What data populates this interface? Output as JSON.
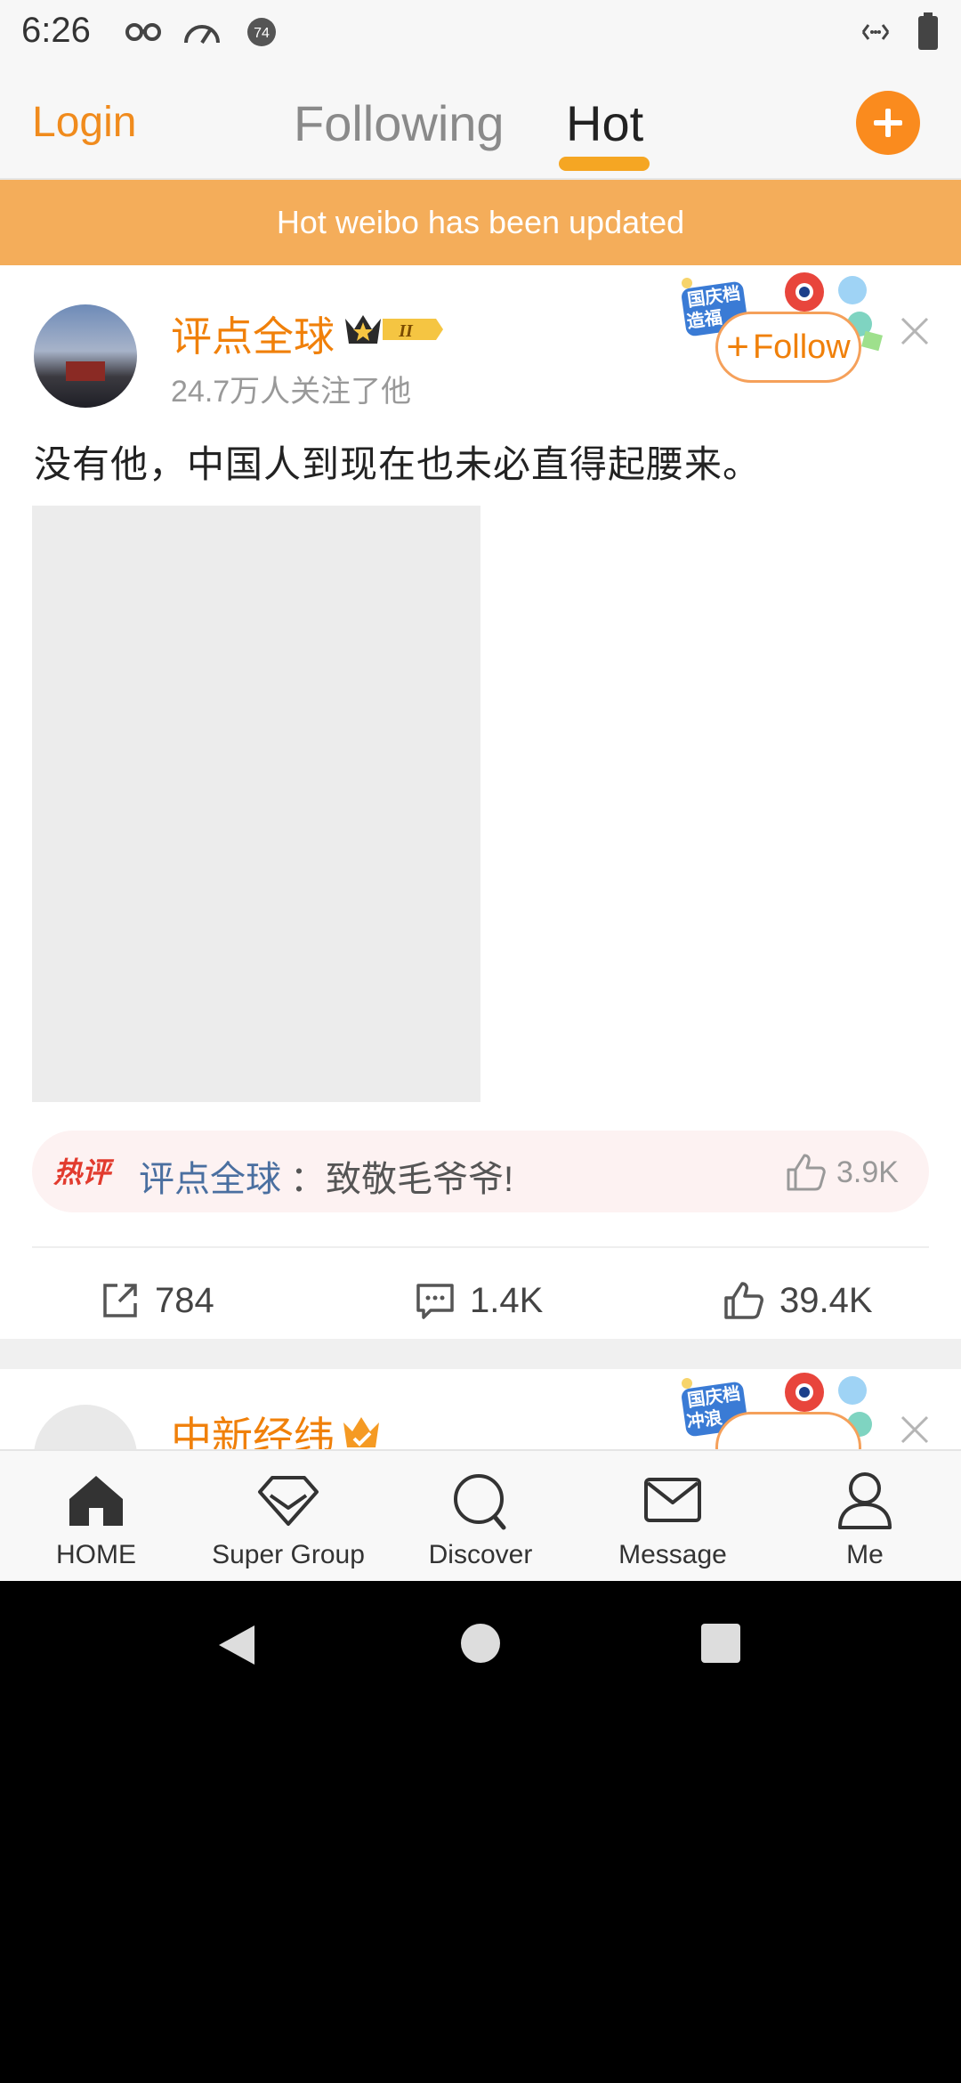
{
  "status_bar": {
    "time": "6:26",
    "notification_badge": "74",
    "icons": [
      "incognito-icon",
      "speedometer-icon",
      "notification-badge-icon",
      "data-transfer-icon",
      "battery-icon"
    ]
  },
  "header": {
    "login_label": "Login",
    "tabs": [
      {
        "label": "Following",
        "active": false
      },
      {
        "label": "Hot",
        "active": true
      }
    ],
    "compose_icon": "plus-icon",
    "accent_color": "#f08b1d"
  },
  "banner": {
    "text": "Hot weibo has been updated",
    "color": "#f4ad5a"
  },
  "post": {
    "username": "评点全球",
    "level_badge": "II",
    "followers": "24.7万人关注了他",
    "follow_label": "Follow",
    "festive_text": "国庆档",
    "festive_text_2": "造福",
    "text": "没有他，中国人到现在也未必直得起腰来。",
    "hot_comment": {
      "label": "热评",
      "user": "评点全球",
      "text": "：致敬毛爷爷!",
      "likes": "3.9K"
    },
    "actions": {
      "reposts": "784",
      "comments": "1.4K",
      "likes": "39.4K"
    }
  },
  "next_post": {
    "username": "中新经纬",
    "festive_text": "国庆档",
    "festive_text_2": "冲浪"
  },
  "bottom_nav": [
    {
      "label": "HOME",
      "icon": "home-icon"
    },
    {
      "label": "Super Group",
      "icon": "diamond-icon"
    },
    {
      "label": "Discover",
      "icon": "search-icon"
    },
    {
      "label": "Message",
      "icon": "envelope-icon"
    },
    {
      "label": "Me",
      "icon": "profile-icon"
    }
  ]
}
